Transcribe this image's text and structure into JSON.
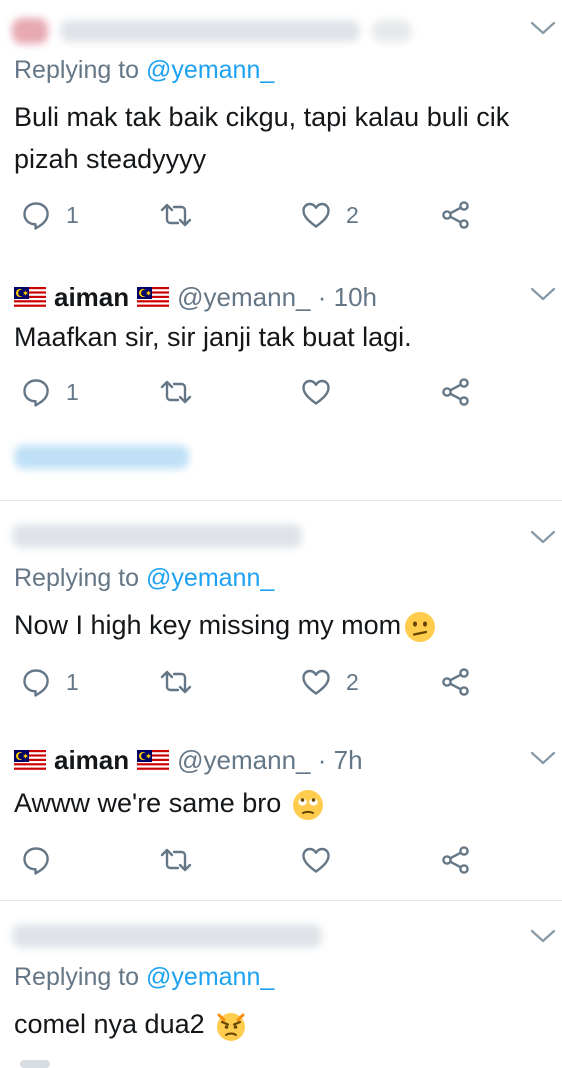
{
  "replies": [
    {
      "replying_prefix": "Replying to",
      "replying_handle": "@yemann_",
      "text": "Buli mak tak baik cikgu, tapi kalau buli cik",
      "text2": "pizah steadyyyy",
      "reply_count": "1",
      "like_count": "2"
    },
    {
      "name": "aiman",
      "handle_time": "@yemann_ · 10h",
      "text": "Maafkan sir, sir janji tak buat lagi.",
      "reply_count": "1"
    },
    {
      "replying_prefix": "Replying to",
      "replying_handle": "@yemann_",
      "text": "Now I high key missing my mom",
      "reply_count": "1",
      "like_count": "2"
    },
    {
      "name": "aiman",
      "handle_time": "@yemann_ · 7h",
      "text": "Awww we're same bro"
    },
    {
      "replying_prefix": "Replying to",
      "replying_handle": "@yemann_",
      "text": "comel nya dua2"
    }
  ],
  "icons": {
    "reply": "reply-icon",
    "retweet": "retweet-icon",
    "like": "heart-icon",
    "share": "share-icon",
    "more": "chevron-down-icon",
    "flag": "malaysia-flag-icon"
  },
  "colors": {
    "text": "#14171a",
    "secondary": "#657786",
    "link": "#1da1f2",
    "divider": "#e1e8ed"
  }
}
